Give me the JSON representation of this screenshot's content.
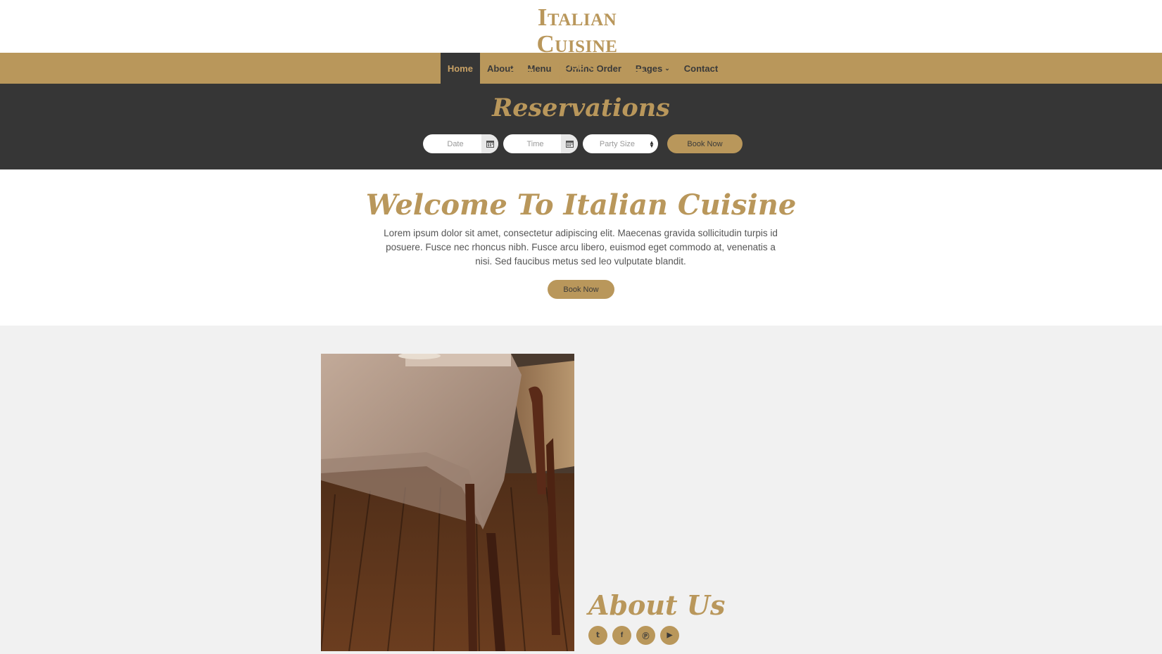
{
  "brand": {
    "title": "Italian Cuisine",
    "subtitle": "Food & Drinks"
  },
  "nav": {
    "items": [
      {
        "label": "Home",
        "active": true
      },
      {
        "label": "About"
      },
      {
        "label": "Menu"
      },
      {
        "label": "Online Order"
      },
      {
        "label": "Pages",
        "has_dropdown": true
      },
      {
        "label": "Contact"
      }
    ]
  },
  "reservations": {
    "title": "Reservations",
    "date_placeholder": "Date",
    "time_placeholder": "Time",
    "party_placeholder": "Party Size",
    "button_label": "Book Now"
  },
  "welcome": {
    "title": "Welcome To Italian Cuisine",
    "text": "Lorem ipsum dolor sit amet, consectetur adipiscing elit. Maecenas gravida sollicitudin turpis id posuere. Fusce nec rhoncus nibh. Fusce arcu libero, euismod eget commodo at, venenatis a nisi. Sed faucibus metus sed leo vulputate blandit.",
    "button_label": "Book Now"
  },
  "about": {
    "title": "About Us",
    "socials": [
      "twitter-icon",
      "facebook-icon",
      "pinterest-icon",
      "youtube-icon"
    ]
  },
  "colors": {
    "accent": "#b9975b",
    "dark": "#363636"
  }
}
